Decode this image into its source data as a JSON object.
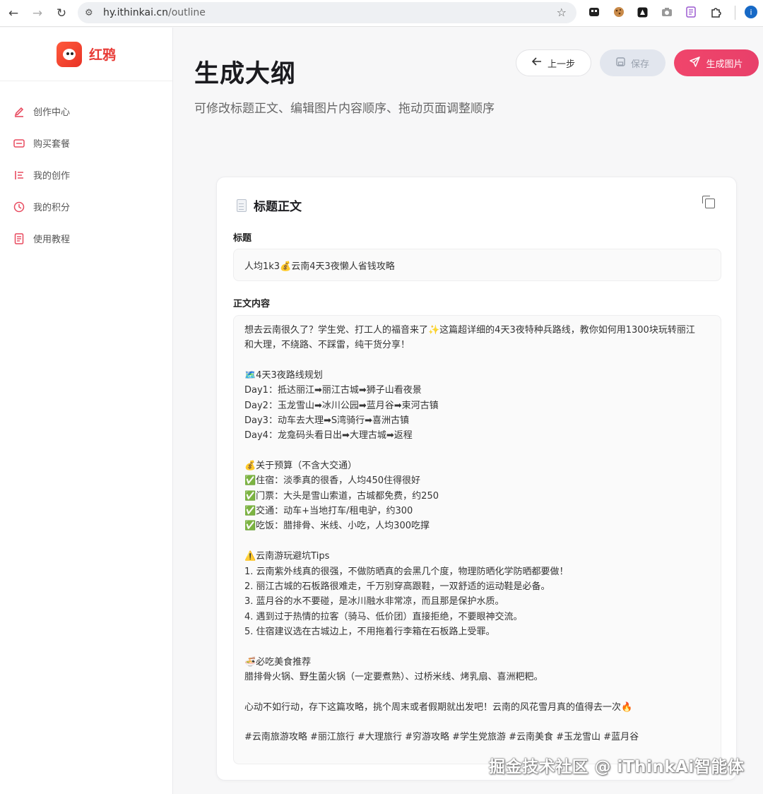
{
  "browser": {
    "url_host": "hy.ithinkai.cn",
    "url_path": "/outline",
    "profile_initial": "i"
  },
  "sidebar": {
    "brand": "红鸦",
    "items": [
      {
        "label": "创作中心",
        "icon": "pen-icon"
      },
      {
        "label": "购买套餐",
        "icon": "card-icon"
      },
      {
        "label": "我的创作",
        "icon": "list-icon"
      },
      {
        "label": "我的积分",
        "icon": "clock-icon"
      },
      {
        "label": "使用教程",
        "icon": "book-icon"
      }
    ]
  },
  "header": {
    "title": "生成大纲",
    "subtitle": "可修改标题正文、编辑图片内容顺序、拖动页面调整顺序",
    "back_label": "上一步",
    "save_label": "保存",
    "generate_label": "生成图片"
  },
  "card": {
    "title": "标题正文",
    "title_label": "标题",
    "title_value": "人均1k3💰云南4天3夜懒人省钱攻略",
    "body_label": "正文内容",
    "body_lines": [
      "想去云南很久了？学生党、打工人的福音来了✨这篇超详细的4天3夜特种兵路线，教你如何用1300块玩转丽江",
      "和大理，不绕路、不踩雷，纯干货分享！",
      "",
      "🗺️4天3夜路线规划",
      "Day1：抵达丽江➡丽江古城➡狮子山看夜景",
      "Day2：玉龙雪山➡冰川公园➡蓝月谷➡束河古镇",
      "Day3：动车去大理➡S湾骑行➡喜洲古镇",
      "Day4：龙龛码头看日出➡大理古城➡返程",
      "",
      "💰关于预算（不含大交通）",
      "✅住宿：淡季真的很香，人均450住得很好",
      "✅门票：大头是雪山索道，古城都免费，约250",
      "✅交通：动车+当地打车/租电驴，约300",
      "✅吃饭：腊排骨、米线、小吃，人均300吃撑",
      "",
      "⚠️云南游玩避坑Tips",
      "1. 云南紫外线真的很强，不做防晒真的会黑几个度，物理防晒化学防晒都要做！",
      "2. 丽江古城的石板路很难走，千万别穿高跟鞋，一双舒适的运动鞋是必备。",
      "3. 蓝月谷的水不要碰，是冰川融水非常凉，而且那是保护水质。",
      "4. 遇到过于热情的拉客（骑马、低价团）直接拒绝，不要眼神交流。",
      "5. 住宿建议选在古城边上，不用拖着行李箱在石板路上受罪。",
      "",
      "🍜必吃美食推荐",
      "腊排骨火锅、野生菌火锅（一定要煮熟）、过桥米线、烤乳扇、喜洲粑粑。",
      "",
      "心动不如行动，存下这篇攻略，挑个周末或者假期就出发吧！云南的风花雪月真的值得去一次🔥",
      "",
      "#云南旅游攻略 #丽江旅行 #大理旅行 #穷游攻略 #学生党旅游 #云南美食 #玉龙雪山 #蓝月谷"
    ]
  },
  "watermark": "掘金技术社区 @ iThinkAi智能体",
  "colors": {
    "accent": "#e8406a",
    "brand_red": "#e83a35",
    "save_disabled_bg": "#e2e6ee"
  }
}
